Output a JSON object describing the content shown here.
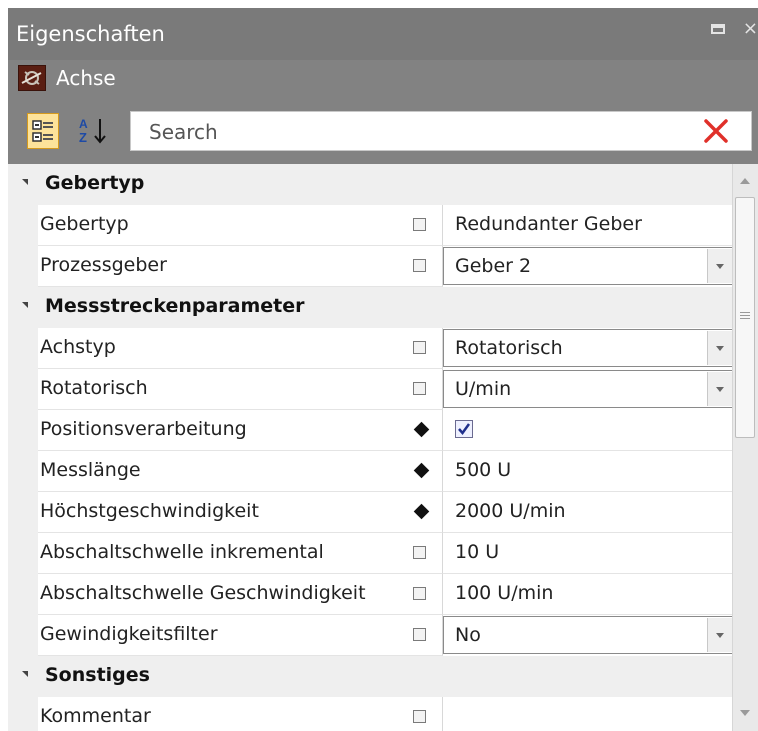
{
  "panel": {
    "title": "Eigenschaften",
    "restore_icon": "restore-window-icon",
    "close_icon": "close-icon",
    "close_glyph": "×"
  },
  "object": {
    "label": "Achse",
    "icon": "axis-object-icon"
  },
  "toolbar": {
    "categorized_icon": "categorized-view-icon",
    "alphabetical_icon": "sort-az-icon",
    "search_placeholder": "Search",
    "search_value": "",
    "clear_icon": "clear-search-icon"
  },
  "categories": [
    {
      "label": "Gebertyp"
    },
    {
      "label": "Messstreckenparameter"
    },
    {
      "label": "Sonstiges"
    }
  ],
  "rows": [
    {
      "name": "Gebertyp",
      "value": "Redundanter Geber"
    },
    {
      "name": "Prozessgeber",
      "value": "Geber 2"
    },
    {
      "name": "Achstyp",
      "value": "Rotatorisch"
    },
    {
      "name": "Rotatorisch",
      "value": "U/min"
    },
    {
      "name": "Positionsverarbeitung",
      "value": ""
    },
    {
      "name": "Messlänge",
      "value": "500 U"
    },
    {
      "name": "Höchstgeschwindigkeit",
      "value": "2000 U/min"
    },
    {
      "name": "Abschaltschwelle inkremental",
      "value": "10 U"
    },
    {
      "name": "Abschaltschwelle Geschwindigkeit",
      "value": "100 U/min"
    },
    {
      "name": "Gewindigkeitsfilter",
      "value": "No"
    },
    {
      "name": "Kommentar",
      "value": ""
    }
  ],
  "state": {
    "positionsverarbeitung_checked": true
  },
  "colors": {
    "title_background": "#7a7a7a",
    "toolbar_background": "#828282",
    "active_view_button": "#fde39a",
    "clear_search": "#e0302a"
  }
}
